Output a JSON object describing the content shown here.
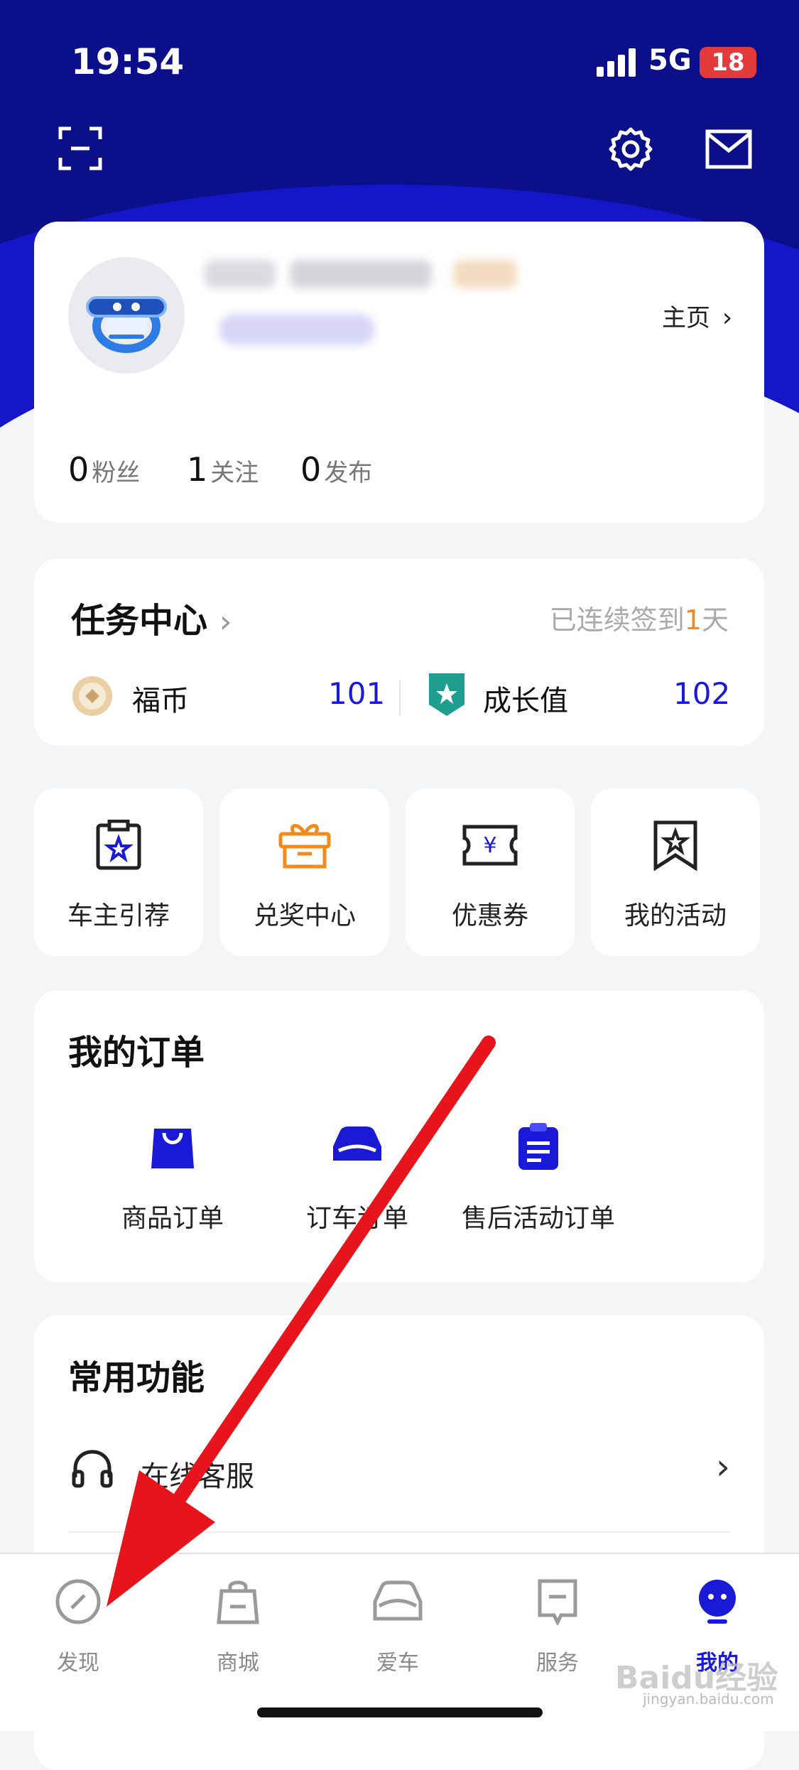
{
  "status_bar": {
    "time": "19:54",
    "network": "5G",
    "battery": "18"
  },
  "header": {
    "scan_icon": "scan-icon",
    "settings_icon": "gear-icon",
    "message_icon": "mail-icon"
  },
  "profile": {
    "homepage_label": "主页",
    "stats": [
      {
        "value": "0",
        "label": "粉丝"
      },
      {
        "value": "1",
        "label": "关注"
      },
      {
        "value": "0",
        "label": "发布"
      }
    ]
  },
  "tasks": {
    "title": "任务中心",
    "checkin_prefix": "已连续签到",
    "checkin_days": "1",
    "checkin_suffix": "天",
    "coin_label": "福币",
    "coin_value": "101",
    "growth_label": "成长值",
    "growth_value": "102"
  },
  "quick_links": [
    {
      "label": "车主引荐",
      "icon": "clipboard-star-icon"
    },
    {
      "label": "兑奖中心",
      "icon": "gift-box-icon"
    },
    {
      "label": "优惠券",
      "icon": "coupon-icon"
    },
    {
      "label": "我的活动",
      "icon": "bookmark-star-icon"
    }
  ],
  "orders": {
    "title": "我的订单",
    "items": [
      {
        "label": "商品订单",
        "icon": "shopping-bag-icon"
      },
      {
        "label": "订车订单",
        "icon": "car-icon"
      },
      {
        "label": "售后活动订单",
        "icon": "clipboard-list-icon"
      }
    ]
  },
  "functions": {
    "title": "常用功能",
    "items": [
      {
        "label": "在线客服",
        "icon": "headset-icon"
      }
    ]
  },
  "tabbar": {
    "items": [
      {
        "label": "发现",
        "icon": "compass-icon"
      },
      {
        "label": "商城",
        "icon": "shopping-bag-icon"
      },
      {
        "label": "爱车",
        "icon": "car-front-icon"
      },
      {
        "label": "服务",
        "icon": "service-card-icon"
      },
      {
        "label": "我的",
        "icon": "avatar-face-icon"
      }
    ]
  },
  "watermark": {
    "brand": "Baidu经验",
    "url": "jingyan.baidu.com"
  },
  "colors": {
    "accent": "#1a1ad6",
    "header_dark": "#0b0f8a",
    "orange": "#f28a1c",
    "arrow_red": "#e8141b"
  }
}
